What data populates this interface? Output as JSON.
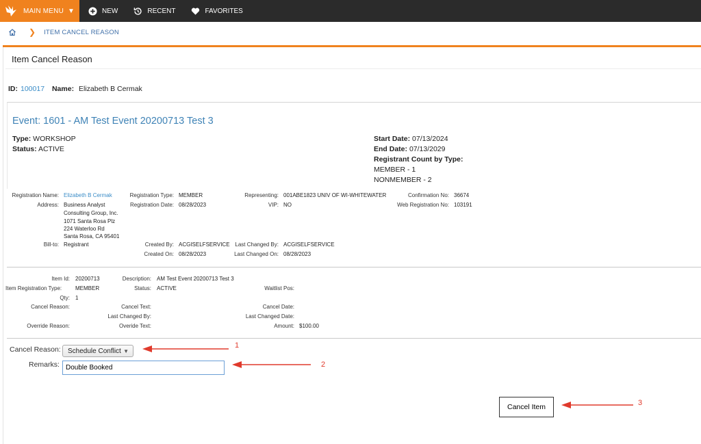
{
  "topbar": {
    "menu_label": "MAIN MENU",
    "items": [
      {
        "label": "NEW",
        "icon": "plus-circle-icon"
      },
      {
        "label": "RECENT",
        "icon": "history-icon"
      },
      {
        "label": "FAVORITES",
        "icon": "heart-icon"
      }
    ],
    "accent_color": "#f0821e",
    "bar_color": "#2b2b2b"
  },
  "breadcrumb": {
    "current": "ITEM CANCEL REASON"
  },
  "page_title": "Item Cancel Reason",
  "record": {
    "id_label": "ID:",
    "id_value": "100017",
    "name_label": "Name:",
    "name_value": "Elizabeth B Cermak"
  },
  "event": {
    "title": "Event: 1601 - AM Test Event 20200713 Test 3",
    "type_label": "Type:",
    "type_value": "WORKSHOP",
    "status_label": "Status:",
    "status_value": "ACTIVE",
    "start_label": "Start Date:",
    "start_value": "07/13/2024",
    "end_label": "End Date:",
    "end_value": "07/13/2029",
    "count_label": "Registrant Count by Type:",
    "counts": [
      "MEMBER - 1",
      "NONMEMBER - 2"
    ]
  },
  "registration": {
    "reg_name_label": "Registration Name:",
    "reg_name_value": "Elizabeth B Cermak",
    "address_label": "Address:",
    "address_lines": [
      "Business Analyst",
      "Consulting Group, Inc.",
      "1071 Santa Rosa Plz",
      "224 Waterloo Rd",
      "Santa Rosa, CA 95401"
    ],
    "billto_label": "Bill-to:",
    "billto_value": "Registrant",
    "reg_type_label": "Registration Type:",
    "reg_type_value": "MEMBER",
    "reg_date_label": "Registration Date:",
    "reg_date_value": "08/28/2023",
    "created_by_label": "Created By:",
    "created_by_value": "ACGISELFSERVICE",
    "created_on_label": "Created On:",
    "created_on_value": "08/28/2023",
    "representing_label": "Representing:",
    "representing_value": "001ABE1823 UNIV OF WI-WHITEWATER",
    "vip_label": "VIP:",
    "vip_value": "NO",
    "last_changed_by_label": "Last Changed By:",
    "last_changed_by_value": "ACGISELFSERVICE",
    "last_changed_on_label": "Last Changed On:",
    "last_changed_on_value": "08/28/2023",
    "conf_label": "Confirmation No:",
    "conf_value": "36674",
    "webreg_label": "Web Registration No:",
    "webreg_value": "103191"
  },
  "item": {
    "item_id_label": "Item Id:",
    "item_id_value": "20200713",
    "item_reg_type_label": "Item Registration Type:",
    "item_reg_type_value": "MEMBER",
    "qty_label": "Qty:",
    "qty_value": "1",
    "cancel_reason_label": "Cancel Reason:",
    "override_reason_label": "Override Reason:",
    "description_label": "Description:",
    "description_value": "AM Test Event 20200713 Test 3",
    "status_label": "Status:",
    "status_value": "ACTIVE",
    "cancel_text_label": "Cancel Text:",
    "last_changed_by_label": "Last Changed By:",
    "override_text_label": "Overide Text:",
    "waitlist_label": "Waitlist Pos:",
    "cancel_date_label": "Cancel Date:",
    "last_changed_date_label": "Last Changed Date:",
    "amount_label": "Amount:",
    "amount_value": "$100.00"
  },
  "form": {
    "cancel_reason_label": "Cancel Reason:",
    "cancel_reason_value": "Schedule Conflict",
    "remarks_label": "Remarks:",
    "remarks_value": "Double Booked",
    "submit_label": "Cancel Item"
  },
  "annotations": [
    "1",
    "2",
    "3"
  ],
  "annotation_color": "#e03a2c"
}
